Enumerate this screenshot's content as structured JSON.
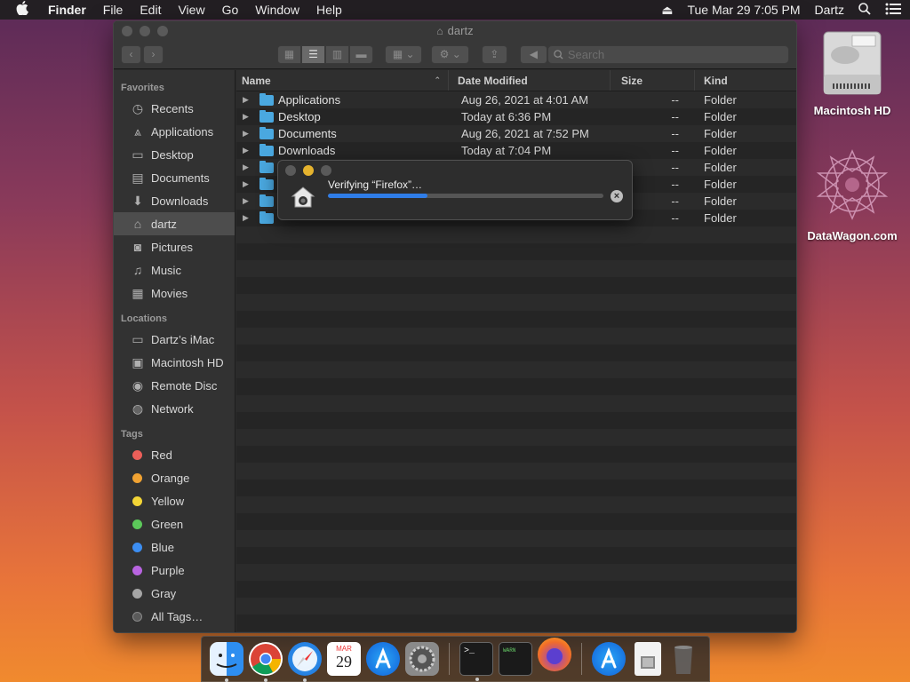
{
  "menubar": {
    "app": "Finder",
    "items": [
      "File",
      "Edit",
      "View",
      "Go",
      "Window",
      "Help"
    ],
    "datetime": "Tue Mar 29  7:05 PM",
    "user": "Dartz"
  },
  "window": {
    "title": "dartz",
    "search_placeholder": "Search"
  },
  "sidebar": {
    "favorites_label": "Favorites",
    "favorites": [
      {
        "label": "Recents",
        "icon": "clock-icon"
      },
      {
        "label": "Applications",
        "icon": "applications-icon"
      },
      {
        "label": "Desktop",
        "icon": "desktop-icon"
      },
      {
        "label": "Documents",
        "icon": "document-icon"
      },
      {
        "label": "Downloads",
        "icon": "download-icon"
      },
      {
        "label": "dartz",
        "icon": "home-icon"
      },
      {
        "label": "Pictures",
        "icon": "camera-icon"
      },
      {
        "label": "Music",
        "icon": "music-icon"
      },
      {
        "label": "Movies",
        "icon": "film-icon"
      }
    ],
    "locations_label": "Locations",
    "locations": [
      {
        "label": "Dartz’s iMac",
        "icon": "imac-icon"
      },
      {
        "label": "Macintosh HD",
        "icon": "disk-icon"
      },
      {
        "label": "Remote Disc",
        "icon": "disc-icon"
      },
      {
        "label": "Network",
        "icon": "globe-icon"
      }
    ],
    "tags_label": "Tags",
    "tags": [
      {
        "label": "Red",
        "color": "#ec5f59"
      },
      {
        "label": "Orange",
        "color": "#f0a232"
      },
      {
        "label": "Yellow",
        "color": "#f3d536"
      },
      {
        "label": "Green",
        "color": "#5cc85a"
      },
      {
        "label": "Blue",
        "color": "#3c8ef2"
      },
      {
        "label": "Purple",
        "color": "#b864e0"
      },
      {
        "label": "Gray",
        "color": "#a5a5a5"
      },
      {
        "label": "All Tags…",
        "color": "#5a5a5a"
      }
    ]
  },
  "columns": {
    "name": "Name",
    "date": "Date Modified",
    "size": "Size",
    "kind": "Kind"
  },
  "files": [
    {
      "name": "Applications",
      "date": "Aug 26, 2021 at 4:01 AM",
      "size": "--",
      "kind": "Folder"
    },
    {
      "name": "Desktop",
      "date": "Today at 6:36 PM",
      "size": "--",
      "kind": "Folder"
    },
    {
      "name": "Documents",
      "date": "Aug 26, 2021 at 7:52 PM",
      "size": "--",
      "kind": "Folder"
    },
    {
      "name": "Downloads",
      "date": "Today at 7:04 PM",
      "size": "--",
      "kind": "Folder"
    },
    {
      "name": "",
      "date": "",
      "size": "--",
      "kind": "Folder"
    },
    {
      "name": "",
      "date": "",
      "size": "--",
      "kind": "Folder"
    },
    {
      "name": "",
      "date": "",
      "size": "--",
      "kind": "Folder"
    },
    {
      "name": "",
      "date": "",
      "size": "--",
      "kind": "Folder"
    }
  ],
  "dialog": {
    "title": "Verifying “Firefox”…",
    "progress": 0.36
  },
  "desktop": {
    "icons": [
      {
        "label": "Macintosh HD"
      },
      {
        "label": "DataWagon.com"
      }
    ]
  },
  "dock": {
    "items": [
      "Finder",
      "Chrome",
      "Safari",
      "Calendar",
      "App Store",
      "System Preferences",
      "Terminal",
      "Console",
      "Firefox",
      "App Store",
      "Preview",
      "Trash"
    ],
    "calendar_month": "MAR",
    "calendar_day": "29"
  },
  "colors": {
    "accent": "#2f7de8",
    "folder": "#4aa8e0"
  }
}
